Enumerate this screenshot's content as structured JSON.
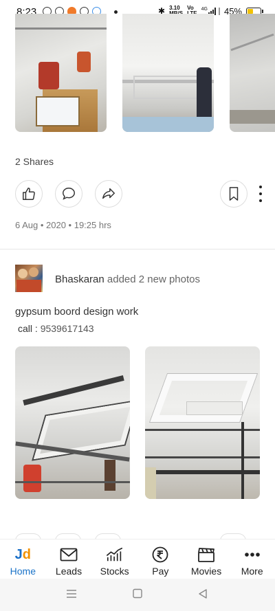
{
  "status_bar": {
    "time": "8:23",
    "net_speed_top": "3.10",
    "net_speed_unit": "MB/S",
    "volte_top": "Vo",
    "volte_bottom": "LTE",
    "network": "4G",
    "battery_percent": "45%",
    "battery_level": 0.45,
    "battery_color": "#f2c200"
  },
  "previous_post": {
    "shares_text": "2 Shares",
    "date": "6 Aug • 2020 • 19:25 hrs"
  },
  "post": {
    "author": "Bhaskaran",
    "action": "added 2 new photos",
    "text": "gypsum boord design work",
    "call_label": "call : ",
    "phone": "9539617143"
  },
  "bottom_nav": {
    "items": [
      {
        "label": "Home",
        "icon": "jd-logo-icon",
        "active": true
      },
      {
        "label": "Leads",
        "icon": "mail-icon"
      },
      {
        "label": "Stocks",
        "icon": "chart-icon"
      },
      {
        "label": "Pay",
        "icon": "rupee-icon"
      },
      {
        "label": "Movies",
        "icon": "clapperboard-icon"
      },
      {
        "label": "More",
        "icon": "more-dots-icon"
      }
    ],
    "logo_j": "J",
    "logo_d": "d",
    "active_color": "#1a73c8"
  }
}
